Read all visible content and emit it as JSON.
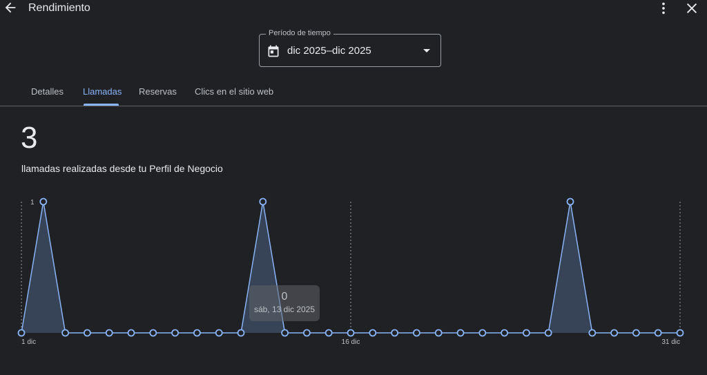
{
  "header": {
    "title": "Rendimiento",
    "back_icon": "arrow-back-icon",
    "more_icon": "more-vert-icon",
    "close_icon": "close-icon"
  },
  "period": {
    "label": "Período de tiempo",
    "value": "dic 2025–dic 2025",
    "icon": "calendar-icon"
  },
  "tabs": [
    {
      "label": "Detalles",
      "active": false
    },
    {
      "label": "Llamadas",
      "active": true
    },
    {
      "label": "Reservas",
      "active": false
    },
    {
      "label": "Clics en el sitio web",
      "active": false
    }
  ],
  "summary": {
    "total": "3",
    "description": "llamadas realizadas desde tu Perfil de Negocio"
  },
  "tooltip": {
    "value": "0",
    "date": "sáb, 13 dic 2025"
  },
  "colors": {
    "accent": "#8ab4f8",
    "background": "#202124",
    "area_fill": "#3c4a62"
  },
  "chart_data": {
    "type": "area",
    "x": [
      1,
      2,
      3,
      4,
      5,
      6,
      7,
      8,
      9,
      10,
      11,
      12,
      13,
      14,
      15,
      16,
      17,
      18,
      19,
      20,
      21,
      22,
      23,
      24,
      25,
      26,
      27,
      28,
      29,
      30,
      31
    ],
    "values": [
      0,
      1,
      0,
      0,
      0,
      0,
      0,
      0,
      0,
      0,
      0,
      1,
      0,
      0,
      0,
      0,
      0,
      0,
      0,
      0,
      0,
      0,
      0,
      0,
      0,
      1,
      0,
      0,
      0,
      0,
      0
    ],
    "y_tick_labels": [
      "1"
    ],
    "x_tick_labels": [
      {
        "day": 1,
        "label": "1 dic"
      },
      {
        "day": 16,
        "label": "16 dic"
      },
      {
        "day": 31,
        "label": "31 dic"
      }
    ],
    "ylim": [
      0,
      1
    ],
    "xlim": [
      1,
      31
    ],
    "grid": "vertical dashed at 1, 16, 31"
  }
}
